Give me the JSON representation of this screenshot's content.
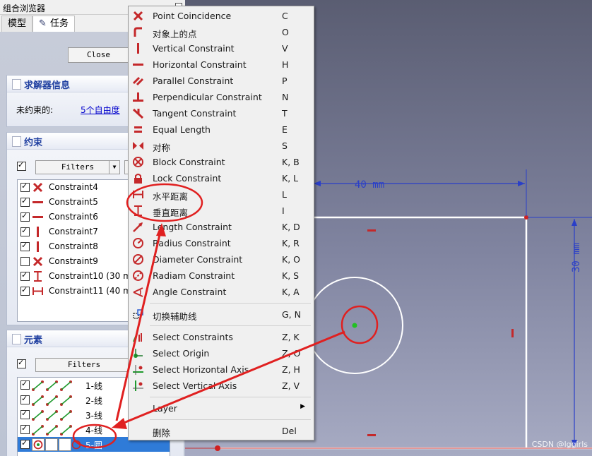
{
  "combo": {
    "title": "组合浏览器",
    "tabs": [
      {
        "label": "模型"
      },
      {
        "label": "任务"
      }
    ],
    "close_label": "Close",
    "solver": {
      "title": "求解器信息",
      "label": "未约束的:",
      "link": "5个自由度"
    },
    "constraints": {
      "title": "约束",
      "filter_label": "Filters",
      "items": [
        {
          "label": "Constraint4",
          "checked": true,
          "icon": "point-coincidence-icon"
        },
        {
          "label": "Constraint5",
          "checked": true,
          "icon": "horizontal-constraint-icon"
        },
        {
          "label": "Constraint6",
          "checked": true,
          "icon": "horizontal-constraint-icon"
        },
        {
          "label": "Constraint7",
          "checked": true,
          "icon": "vertical-constraint-icon"
        },
        {
          "label": "Constraint8",
          "checked": true,
          "icon": "vertical-constraint-icon"
        },
        {
          "label": "Constraint9",
          "checked": false,
          "icon": "point-coincidence-icon"
        },
        {
          "label": "Constraint10 (30 mm)",
          "checked": true,
          "icon": "vertical-distance-icon"
        },
        {
          "label": "Constraint11 (40 mm)",
          "checked": true,
          "icon": "horizontal-distance-icon"
        }
      ]
    },
    "elements": {
      "title": "元素",
      "filter_label": "Filters",
      "items": [
        {
          "label": "1-线",
          "checked": true,
          "selected": false
        },
        {
          "label": "2-线",
          "checked": true,
          "selected": false
        },
        {
          "label": "3-线",
          "checked": true,
          "selected": false
        },
        {
          "label": "4-线",
          "checked": true,
          "selected": false
        },
        {
          "label": "5-圆",
          "checked": true,
          "selected": true
        }
      ]
    }
  },
  "menu": {
    "items": [
      {
        "label": "Point Coincidence",
        "key": "C",
        "icon": "point-coincidence-icon"
      },
      {
        "label": "对象上的点",
        "key": "O",
        "icon": "point-on-object-icon"
      },
      {
        "label": "Vertical Constraint",
        "key": "V",
        "icon": "vertical-constraint-icon"
      },
      {
        "label": "Horizontal Constraint",
        "key": "H",
        "icon": "horizontal-constraint-icon"
      },
      {
        "label": "Parallel Constraint",
        "key": "P",
        "icon": "parallel-constraint-icon"
      },
      {
        "label": "Perpendicular Constraint",
        "key": "N",
        "icon": "perpendicular-constraint-icon"
      },
      {
        "label": "Tangent Constraint",
        "key": "T",
        "icon": "tangent-constraint-icon"
      },
      {
        "label": "Equal Length",
        "key": "E",
        "icon": "equal-length-icon"
      },
      {
        "label": "对称",
        "key": "S",
        "icon": "symmetric-icon"
      },
      {
        "label": "Block Constraint",
        "key": "K, B",
        "icon": "block-constraint-icon"
      },
      {
        "label": "Lock Constraint",
        "key": "K, L",
        "icon": "lock-icon"
      },
      {
        "label": "水平距离",
        "key": "L",
        "icon": "horizontal-distance-icon"
      },
      {
        "label": "垂直距离",
        "key": "I",
        "icon": "vertical-distance-icon"
      },
      {
        "label": "Length Constraint",
        "key": "K, D",
        "icon": "length-constraint-icon"
      },
      {
        "label": "Radius Constraint",
        "key": "K, R",
        "icon": "radius-constraint-icon"
      },
      {
        "label": "Diameter Constraint",
        "key": "K, O",
        "icon": "diameter-constraint-icon"
      },
      {
        "label": "Radiam Constraint",
        "key": "K, S",
        "icon": "radiam-constraint-icon"
      },
      {
        "label": "Angle Constraint",
        "key": "K, A",
        "icon": "angle-constraint-icon"
      },
      {
        "label": "切换辅助线",
        "key": "G, N",
        "icon": "toggle-construction-icon"
      },
      {
        "label": "Select Constraints",
        "key": "Z, K",
        "icon": "select-constraints-icon"
      },
      {
        "label": "Select Origin",
        "key": "Z, O",
        "icon": "select-origin-icon"
      },
      {
        "label": "Select Horizontal Axis",
        "key": "Z, H",
        "icon": "select-h-axis-icon"
      },
      {
        "label": "Select Vertical Axis",
        "key": "Z, V",
        "icon": "select-v-axis-icon"
      },
      {
        "label": "Layer",
        "key": "",
        "icon": ""
      },
      {
        "label": "删除",
        "key": "Del",
        "icon": ""
      }
    ]
  },
  "viewport": {
    "dim_horizontal": "40 mm",
    "dim_vertical": "30 mm",
    "watermark": "CSDN @lggirls"
  },
  "colors": {
    "constraint_red": "#c4282a",
    "annotation_red": "#e02020",
    "dimension_blue": "#2a3fc8",
    "selection_blue": "#2f7bd8"
  }
}
